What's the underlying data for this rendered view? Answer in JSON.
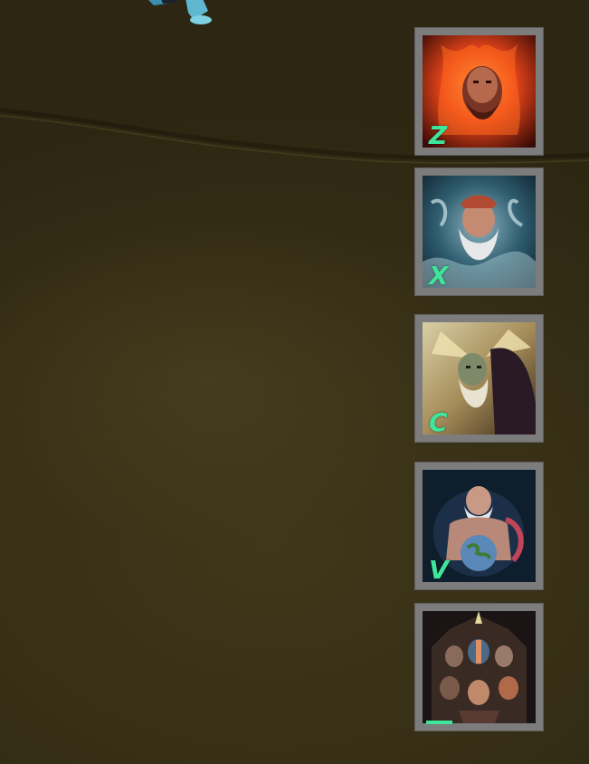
{
  "skills": [
    {
      "key": "Z",
      "icon": "fire-god-portrait-icon",
      "accent": "#e8461a"
    },
    {
      "key": "X",
      "icon": "water-god-portrait-icon",
      "accent": "#3f7f96"
    },
    {
      "key": "C",
      "icon": "wind-god-portrait-icon",
      "accent": "#c9a25a"
    },
    {
      "key": "V",
      "icon": "earth-god-portrait-icon",
      "accent": "#5a88b8"
    },
    {
      "key": "",
      "icon": "pantheon-portrait-icon",
      "accent": "#b0603a",
      "cooldown": true
    }
  ],
  "colors": {
    "key_text": "#3ee59a",
    "slot_frame": "#7c7c7c",
    "ground": "#3a3218"
  }
}
